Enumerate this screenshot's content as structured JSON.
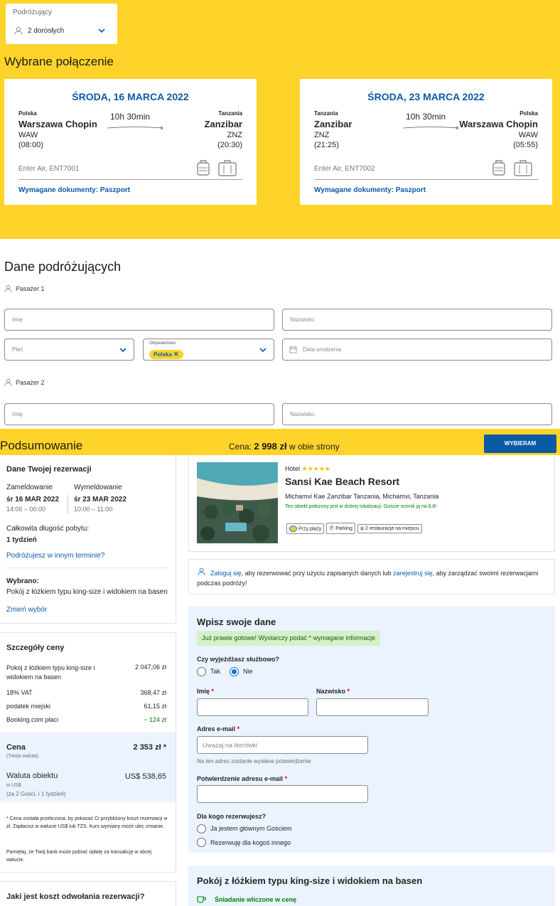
{
  "travellers": {
    "label": "Podróżujący",
    "value": "2 dorosłych"
  },
  "selected_title": "Wybrane połączenie",
  "flights": [
    {
      "date": "ŚRODA, 16 MARCA 2022",
      "from_country": "Polska",
      "from_city": "Warszawa Chopin",
      "from_code": "WAW",
      "from_time": "(08:00)",
      "duration": "10h 30min",
      "to_country": "Tanzania",
      "to_city": "Zanzibar",
      "to_code": "ZNZ",
      "to_time": "(20:30)",
      "flight_no": "Enter Air, ENT7001",
      "docs": "Wymagane dokumenty: Paszport"
    },
    {
      "date": "ŚRODA, 23 MARCA 2022",
      "from_country": "Tanzania",
      "from_city": "Zanzibar",
      "from_code": "ZNZ",
      "from_time": "(21:25)",
      "duration": "10h 30min",
      "to_country": "Polska",
      "to_city": "Warszawa Chopin",
      "to_code": "WAW",
      "to_time": "(05:55)",
      "flight_no": "Enter Air, ENT7002",
      "docs": "Wymagane dokumenty: Paszport"
    }
  ],
  "passengers": {
    "title": "Dane podróżujących",
    "p1": "Pasażer 1",
    "p2": "Pasażer 2",
    "first_name": "Imię",
    "last_name": "Nazwisko",
    "gender": "Płeć",
    "citizenship_label": "Obywatelstwo",
    "citizenship_value": "Polska",
    "birth_date": "Data urodzenia"
  },
  "summary": {
    "title": "Podsumowanie",
    "price_prefix": "Cena: ",
    "price": "2 998 zł",
    "price_suffix": " w obie strony",
    "button": "WYBIERAM"
  },
  "booking": {
    "title": "Dane Twojej rezerwacji",
    "checkin_label": "Zameldowanie",
    "checkin_date": "śr 16 MAR 2022",
    "checkin_time": "14:00 – 00:00",
    "checkout_label": "Wymeldowanie",
    "checkout_date": "śr 23 MAR 2022",
    "checkout_time": "10:00 – 11:00",
    "stay_label": "Całkowita długość pobytu:",
    "stay_value": "1 tydzień",
    "other_dates": "Podróżujesz w innym terminie?",
    "selected_label": "Wybrano:",
    "selected_value": "Pokój z łóżkiem typu king-size i widokiem na basen",
    "change": "Zmień wybór"
  },
  "price_details": {
    "title": "Szczegóły ceny",
    "rows": [
      {
        "label": "Pokój z łóżkiem typu king-size i widokiem na basen",
        "value": "2 047,06 zł"
      },
      {
        "label": "18% VAT",
        "value": "368,47 zł"
      },
      {
        "label": "podatek miejski",
        "value": "61,15 zł"
      },
      {
        "label": "Booking.com płaci",
        "value": "− 124 zł"
      }
    ],
    "total_label": "Cena",
    "total_sub": "(Twoja waluta)",
    "total_value": "2 353 zł *",
    "hotel_currency_label": "Waluta obiektu",
    "hotel_currency_sub1": "w US$",
    "hotel_currency_sub2": "(za 2 Gości, i 1 tydzień)",
    "hotel_currency_value": "US$ 538,65",
    "note1": "* Cena została przeliczona, by pokazać Ci przybliżony koszt rezerwacji w zł. Zapłacisz w walucie US$ lub TZS. Kurs wymiany może ulec zmianie.",
    "note2": "Pamiętaj, że Twój bank może pobrać opłatę za transakcję w obcej walucie."
  },
  "cancel_title": "Jaki jest koszt odwołania rezerwacji?",
  "hotel": {
    "type": "Hotel",
    "stars": "★★★★★",
    "name": "Sansi Kae Beach Resort",
    "address": "Michamvi Kae Zanzibar Tanzania, Michamvi, Tanzania",
    "location_note": "Ten obiekt położony jest w dobrej lokalizacji. Goście ocenili ją na 8,8!",
    "tags": [
      "Przy plaży",
      "Parking",
      "2 restauracje na miejscu"
    ]
  },
  "login": {
    "link1": "Zaloguj się",
    "text1": ", aby rezerwować przy użyciu zapisanych danych lub ",
    "link2": "zarejestruj się",
    "text2": ", aby zarządzać swoimi rezerwacjami podczas podróży!"
  },
  "form": {
    "title": "Wpisz swoje dane",
    "banner_pre": "Już prawie gotowe! Wystarczy podać ",
    "banner_star": "*",
    "banner_post": " wymagane informacje",
    "business_q": "Czy wyjeżdżasz służbowo?",
    "yes": "Tak",
    "no": "Nie",
    "first_name": "Imię",
    "last_name": "Nazwisko",
    "email": "Adres e-mail",
    "email_placeholder": "Uważaj na literówki",
    "email_hint": "Na ten adres zostanie wysłane potwierdzenie",
    "email_confirm": "Potwierdzenie adresu e-mail",
    "for_whom": "Dla kogo rezerwujesz?",
    "opt1": "Ja jestem głównym Gościem",
    "opt2": "Rezerwuję dla kogoś innego",
    "star": "*"
  },
  "room": {
    "title": "Pokój z łóżkiem typu king-size i widokiem na basen",
    "breakfast": "Śniadanie wliczone w cenę"
  },
  "colors": {
    "yellow": "#ffd42a",
    "blue": "#0b5aa5",
    "green": "#008009"
  }
}
